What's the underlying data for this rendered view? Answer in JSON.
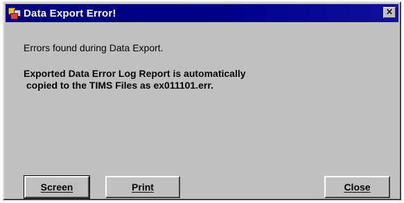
{
  "window": {
    "title": "Data Export Error!",
    "close_glyph": "×",
    "icon": "app-icon"
  },
  "message": {
    "line1": "Errors found during Data Export.",
    "line2": "Exported Data Error Log Report is automatically\n copied to the TIMS Files as ex011101.err."
  },
  "buttons": {
    "screen_label": "Screen",
    "print_label": "Print",
    "close_label": "Close"
  },
  "colors": {
    "titlebar": "#000080",
    "window_face": "#c0c0c0"
  }
}
